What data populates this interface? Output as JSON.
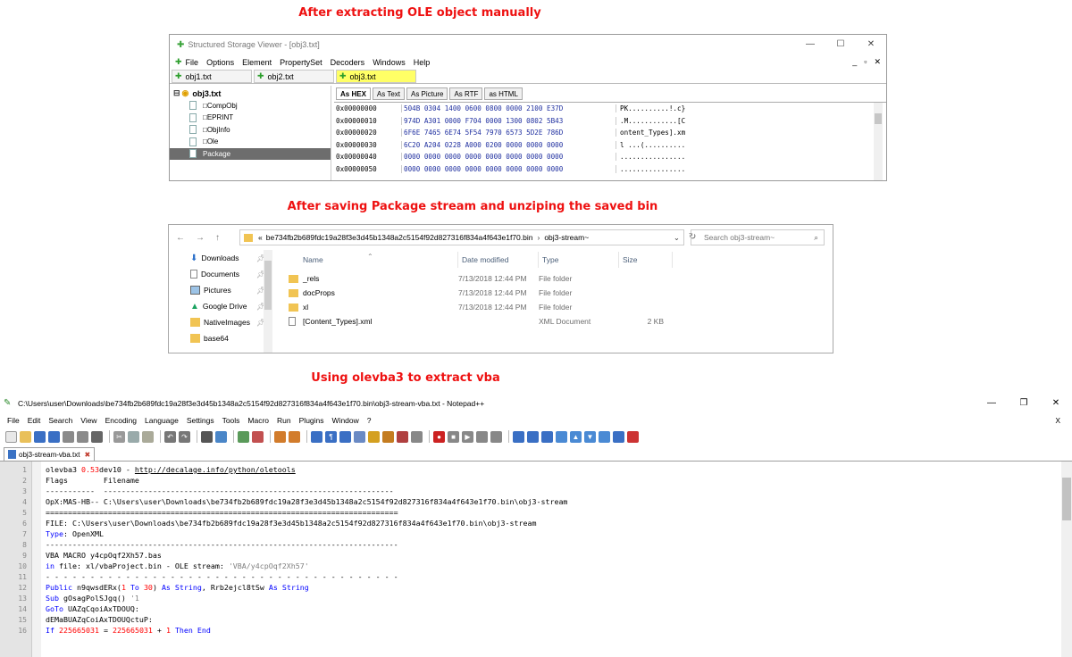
{
  "captions": {
    "top": "After extracting OLE object manually",
    "middle": "After saving Package stream and unziping the saved bin",
    "bottom": "Using olevba3 to extract vba"
  },
  "ssv": {
    "title": "Structured Storage Viewer - [obj3.txt]",
    "win_controls": [
      "—",
      "☐",
      "✕"
    ],
    "menu": [
      "File",
      "Options",
      "Element",
      "PropertySet",
      "Decoders",
      "Windows",
      "Help"
    ],
    "mdi_controls": [
      "_",
      "▫",
      "✕"
    ],
    "doc_tabs": [
      "obj1.txt",
      "obj2.txt",
      "obj3.txt"
    ],
    "tree_root": "obj3.txt",
    "tree_children": [
      "□CompObj",
      "□EPRINT",
      "□ObjInfo",
      "□Ole",
      "Package"
    ],
    "view_tabs": [
      "As HEX",
      "As Text",
      "As Picture",
      "As RTF",
      "as HTML"
    ],
    "hex_rows": [
      {
        "addr": "0x00000000",
        "bytes": "504B 0304 1400 0600 0800 0000 2100 E37D",
        "ascii": "PK..........!.c}"
      },
      {
        "addr": "0x00000010",
        "bytes": "974D A301 0000 F704 0000 1300 0802 5B43",
        "ascii": ".M............[C"
      },
      {
        "addr": "0x00000020",
        "bytes": "6F6E 7465 6E74 5F54 7970 6573 5D2E 786D",
        "ascii": "ontent_Types].xm"
      },
      {
        "addr": "0x00000030",
        "bytes": "6C20 A204 0228 A000 0200 0000 0000 0000",
        "ascii": "l ...(.........."
      },
      {
        "addr": "0x00000040",
        "bytes": "0000 0000 0000 0000 0000 0000 0000 0000",
        "ascii": "................"
      },
      {
        "addr": "0x00000050",
        "bytes": "0000 0000 0000 0000 0000 0000 0000 0000",
        "ascii": "................"
      }
    ]
  },
  "explorer": {
    "nav_back": "←",
    "nav_forward": "→",
    "nav_up": "↑",
    "path_prefix": "«",
    "path_parts": [
      "be734fb2b689fdc19a28f3e3d45b1348a2c5154f92d827316f834a4f643e1f70.bin",
      "obj3-stream~"
    ],
    "search_placeholder": "Search obj3-stream~",
    "nav_items": [
      "Downloads",
      "Documents",
      "Pictures",
      "Google Drive",
      "NativeImages",
      "base64"
    ],
    "columns": [
      "Name",
      "Date modified",
      "Type",
      "Size"
    ],
    "files": [
      {
        "name": "_rels",
        "date": "7/13/2018 12:44 PM",
        "type": "File folder",
        "size": "",
        "kind": "folder"
      },
      {
        "name": "docProps",
        "date": "7/13/2018 12:44 PM",
        "type": "File folder",
        "size": "",
        "kind": "folder"
      },
      {
        "name": "xl",
        "date": "7/13/2018 12:44 PM",
        "type": "File folder",
        "size": "",
        "kind": "folder"
      },
      {
        "name": "[Content_Types].xml",
        "date": "",
        "type": "XML Document",
        "size": "2 KB",
        "kind": "xml"
      }
    ]
  },
  "npp": {
    "title": "C:\\Users\\user\\Downloads\\be734fb2b689fdc19a28f3e3d45b1348a2c5154f92d827316f834a4f643e1f70.bin\\obj3-stream-vba.txt - Notepad++",
    "win_controls": [
      "—",
      "❐",
      "✕"
    ],
    "menu": [
      "File",
      "Edit",
      "Search",
      "View",
      "Encoding",
      "Language",
      "Settings",
      "Tools",
      "Macro",
      "Run",
      "Plugins",
      "Window",
      "?"
    ],
    "menu_close": "X",
    "tab": "obj3-stream-vba.txt",
    "lines": [
      {
        "n": "1",
        "segs": [
          [
            "olevba3 ",
            ""
          ],
          [
            "0.53",
            "num"
          ],
          [
            "dev10 - ",
            ""
          ],
          [
            "http://decalage.info/python/oletools",
            "lnk"
          ]
        ]
      },
      {
        "n": "2",
        "segs": [
          [
            "Flags        Filename",
            ""
          ]
        ]
      },
      {
        "n": "3",
        "segs": [
          [
            "-----------  -----------------------------------------------------------------",
            ""
          ]
        ]
      },
      {
        "n": "4",
        "segs": [
          [
            "OpX:MAS-HB-- C:\\Users\\user\\Downloads\\be734fb2b689fdc19a28f3e3d45b1348a2c5154f92d827316f834a4f643e1f70.bin\\obj3-stream",
            ""
          ]
        ]
      },
      {
        "n": "5",
        "segs": [
          [
            "===============================================================================",
            ""
          ]
        ]
      },
      {
        "n": "6",
        "segs": [
          [
            "FILE: C:\\Users\\user\\Downloads\\be734fb2b689fdc19a28f3e3d45b1348a2c5154f92d827316f834a4f643e1f70.bin\\obj3-stream",
            ""
          ]
        ]
      },
      {
        "n": "7",
        "segs": [
          [
            "Type",
            "kw"
          ],
          [
            ": OpenXML",
            ""
          ]
        ]
      },
      {
        "n": "8",
        "segs": [
          [
            "-------------------------------------------------------------------------------",
            ""
          ]
        ]
      },
      {
        "n": "9",
        "segs": [
          [
            "VBA MACRO y4cpOqf2Xh57.bas",
            ""
          ]
        ]
      },
      {
        "n": "10",
        "segs": [
          [
            "in",
            "kw"
          ],
          [
            " file: xl/vbaProject.bin - OLE stream: ",
            ""
          ],
          [
            "'VBA/y4cpOqf2Xh57'",
            "str"
          ]
        ]
      },
      {
        "n": "11",
        "segs": [
          [
            "- - - - - - - - - - - - - - - - - - - - - - - - - - - - - - - - - - - - - - - -",
            ""
          ]
        ]
      },
      {
        "n": "12",
        "segs": [
          [
            "Public",
            "kw"
          ],
          [
            " n9qwsdERx(",
            ""
          ],
          [
            "1",
            "num"
          ],
          [
            " ",
            ""
          ],
          [
            "To",
            "kw"
          ],
          [
            " ",
            ""
          ],
          [
            "30",
            "num"
          ],
          [
            ") ",
            ""
          ],
          [
            "As String",
            "kw"
          ],
          [
            ", Rrb2ejcl8tSw ",
            ""
          ],
          [
            "As String",
            "kw"
          ]
        ]
      },
      {
        "n": "13",
        "segs": [
          [
            "Sub",
            "kw"
          ],
          [
            " gOsagPolSJgq() ",
            ""
          ],
          [
            "'1",
            "str"
          ]
        ]
      },
      {
        "n": "14",
        "segs": [
          [
            "GoTo",
            "kw"
          ],
          [
            " UAZqCqoiAxTDOUQ:",
            ""
          ]
        ]
      },
      {
        "n": "15",
        "segs": [
          [
            "dEMaBUAZqCoiAxTDOUQctuP:",
            ""
          ]
        ]
      },
      {
        "n": "16",
        "segs": [
          [
            "If",
            "kw"
          ],
          [
            " ",
            ""
          ],
          [
            "225665031",
            "num"
          ],
          [
            " = ",
            ""
          ],
          [
            "225665031",
            "num"
          ],
          [
            " + ",
            ""
          ],
          [
            "1",
            "num"
          ],
          [
            " ",
            ""
          ],
          [
            "Then End",
            "kw"
          ]
        ]
      }
    ]
  }
}
